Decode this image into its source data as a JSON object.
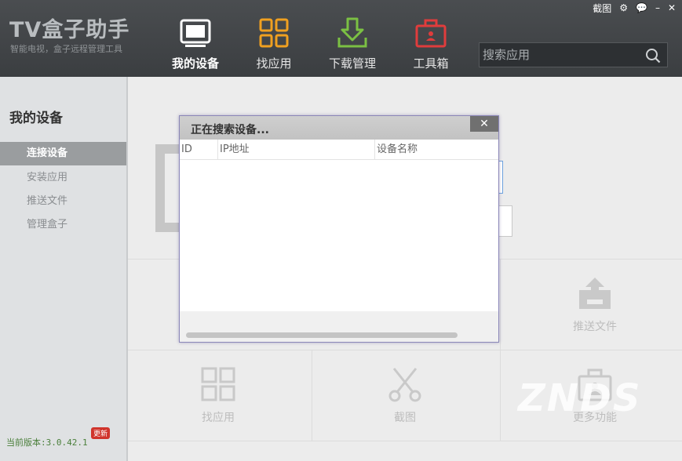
{
  "app": {
    "logo": "TV盒子助手",
    "tagline": "智能电视，盒子远程管理工具"
  },
  "window_controls": {
    "screenshot": "截图",
    "settings_icon": "gear-icon",
    "feedback_icon": "speech-bubble-icon",
    "minimize": "–",
    "close": "✕"
  },
  "nav": [
    {
      "label": "我的设备",
      "icon": "tablet-icon",
      "active": true,
      "color": "#ffffff"
    },
    {
      "label": "找应用",
      "icon": "grid-icon",
      "active": false,
      "color": "#f0a020"
    },
    {
      "label": "下载管理",
      "icon": "download-icon",
      "active": false,
      "color": "#7bc043"
    },
    {
      "label": "工具箱",
      "icon": "toolbox-icon",
      "active": false,
      "color": "#e03c3c"
    }
  ],
  "search": {
    "placeholder": "搜索应用"
  },
  "sidebar": {
    "title": "我的设备",
    "items": [
      {
        "label": "连接设备",
        "active": true
      },
      {
        "label": "安装应用",
        "active": false
      },
      {
        "label": "推送文件",
        "active": false
      },
      {
        "label": "管理盒子",
        "active": false
      }
    ],
    "version": "当前版本:3.0.42.1",
    "update_badge": "更新"
  },
  "tiles": {
    "push_file": "推送文件",
    "find_app": "找应用",
    "screenshot": "截图",
    "more": "更多功能"
  },
  "dialog": {
    "title": "正在搜索设备...",
    "close_label": "✕",
    "columns": [
      "ID",
      "IP地址",
      "设备名称"
    ]
  },
  "watermark": "ZNDS",
  "colors": {
    "accent_orange": "#f0a020",
    "accent_green": "#7bc043",
    "accent_red": "#e03c3c",
    "header_bg": "#414447",
    "dialog_border": "#8b87b8"
  }
}
